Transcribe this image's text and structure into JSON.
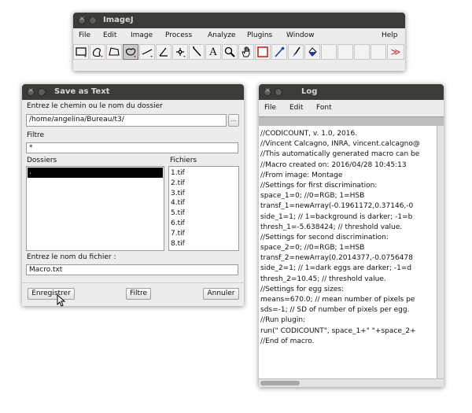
{
  "imagej": {
    "title": "ImageJ",
    "menu": [
      "File",
      "Edit",
      "Image",
      "Process",
      "Analyze",
      "Plugins",
      "Window",
      "Help"
    ],
    "tools": [
      {
        "name": "rectangle-tool-icon"
      },
      {
        "name": "freehand-tool-icon"
      },
      {
        "name": "polygon-tool-icon"
      },
      {
        "name": "oval-tool-icon"
      },
      {
        "name": "line-tool-icon"
      },
      {
        "name": "angle-tool-icon"
      },
      {
        "name": "point-tool-icon"
      },
      {
        "name": "wand-tool-icon"
      },
      {
        "name": "text-tool-icon",
        "glyph": "A"
      },
      {
        "name": "magnifier-tool-icon"
      },
      {
        "name": "hand-tool-icon"
      },
      {
        "name": "color-picker-tool-icon"
      },
      {
        "name": "pipette-tool-icon"
      },
      {
        "name": "brush-tool-icon"
      },
      {
        "name": "flood-fill-tool-icon"
      },
      {
        "name": "empty-tool-slot"
      },
      {
        "name": "empty-tool-slot"
      },
      {
        "name": "empty-tool-slot"
      },
      {
        "name": "empty-tool-slot"
      }
    ],
    "more_tools_glyph": "≫",
    "accent_red": "#cc2222"
  },
  "save_dialog": {
    "title": "Save as Text",
    "path_label": "Entrez le chemin ou le nom du dossier",
    "path_value": "/home/angelina/Bureau/t3/",
    "path_button": "...",
    "filter_label": "Filtre",
    "filter_value": "*",
    "folders_label": "Dossiers",
    "files_label": "Fichiers",
    "folders": [
      "."
    ],
    "files": [
      "1.tif",
      "2.tif",
      "3.tif",
      "4.tif",
      "5.tif",
      "6.tif",
      "7.tif",
      "8.tif"
    ],
    "filename_label": "Entrez le nom du fichier :",
    "filename_value": "Macro.txt",
    "buttons": {
      "save": "Enregistrer",
      "filter": "Filtre",
      "cancel": "Annuler"
    }
  },
  "log": {
    "title": "Log",
    "menu": [
      "File",
      "Edit",
      "Font"
    ],
    "lines": [
      "//CODICOUNT, v. 1.0, 2016.",
      "//Vincent Calcagno, INRA, vincent.calcagno@",
      "//This automatically generated macro can be",
      "//Macro created on: 2016/04/28 10:45:13",
      "//From image: Montage",
      "//Settings for first discrimination:",
      " space_1=0; //0=RGB; 1=HSB",
      " transf_1=newArray(-0.1961172,0.37146,-0",
      " side_1=1; // 1=background is darker; -1=b",
      " thresh_1=-5.638424; // threshold value.",
      "//Settings for second discrimination:",
      " space_2=0; //0=RGB; 1=HSB",
      " transf_2=newArray(0.2014377,-0.0756478",
      " side_2=1; // 1=dark eggs are darker; -1=d",
      " thresh_2=10.45; // threshold value.",
      "//Settings for egg sizes:",
      " means=670.0; // mean number of pixels pe",
      " sds=-1; // SD of number of pixels per egg.",
      "//Run plugin:",
      " run(\" CODICOUNT\", space_1+\" \"+space_2+",
      "//End of macro."
    ]
  }
}
